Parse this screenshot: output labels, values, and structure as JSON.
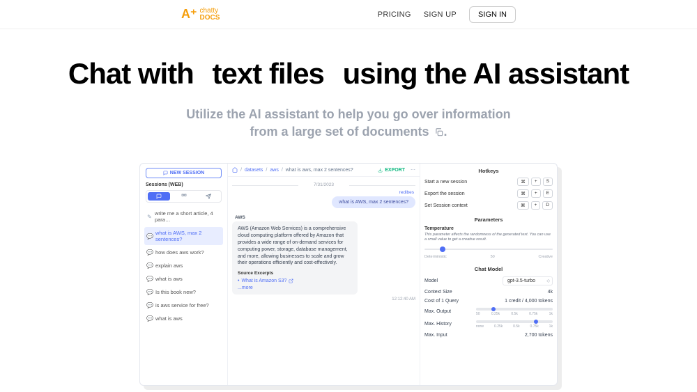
{
  "nav": {
    "pricing": "PRICING",
    "signup": "SIGN UP",
    "signin": "SIGN IN"
  },
  "logo": {
    "chatty": "chatty",
    "docs": "DOCS"
  },
  "hero": {
    "lead": "Chat with",
    "mid": "text files",
    "trail": "using the AI assistant",
    "sub1": "Utilize the AI assistant to help you go over information",
    "sub2": "from a large set of documents"
  },
  "left": {
    "new_session": "NEW SESSION",
    "sessions_label": "Sessions (WEB)",
    "sessions": [
      "write me a short article, 4 para…",
      "what is AWS, max 2 sentences?",
      "how does aws work?",
      "explain aws",
      "what is aws",
      "Is this book new?",
      "is aws service for free?",
      "what is aws"
    ]
  },
  "crumbs": {
    "datasets": "datasets",
    "aws": "aws",
    "current": "what is aws, max 2 sentences?",
    "export": "EXPORT"
  },
  "chat": {
    "date": "7/31/2023",
    "redibes": "redibes",
    "user": "what is AWS, max 2 sentences?",
    "ai_label": "AWS",
    "ai_text": "AWS (Amazon Web Services) is a comprehensive cloud computing platform offered by Amazon that provides a wide range of on-demand services for computing power, storage, database management, and more, allowing businesses to scale and grow their operations efficiently and cost-effectively.",
    "sources_hdr": "Source Excerpts",
    "source1": "What is Amazon S3?",
    "more": "...more",
    "timestamp": "12:12:40 AM"
  },
  "right": {
    "hotkeys_title": "Hotkeys",
    "hk_start": "Start a new session",
    "hk_export": "Export the session",
    "hk_context": "Set Session context",
    "cmd": "⌘",
    "plus": "+",
    "k_s": "S",
    "k_e": "E",
    "k_d": "D",
    "params_title": "Parameters",
    "temp_label": "Temperature",
    "temp_desc": "This parameter affects the randomness of the generated text. You can use a small value to get a creative result.",
    "temp_l0": "Deterministic",
    "temp_l50": "50",
    "temp_l100": "Creative",
    "chatmodel_title": "Chat Model",
    "model_label": "Model",
    "model_value": "gpt-3.5-turbo",
    "ctx_label": "Context Size",
    "ctx_value": "4k",
    "cost_label": "Cost of 1 Query",
    "cost_value": "1 credit  /  4,000 tokens",
    "maxout_label": "Max. Output",
    "maxhist_label": "Max. History",
    "maxin_label": "Max. Input",
    "maxin_value": "2,700 tokens",
    "sl_out": [
      "50",
      "0.25k",
      "0.5k",
      "0.75k",
      "1k"
    ],
    "sl_hist": [
      "none",
      "0.25k",
      "0.5k",
      "0.75k",
      "1k"
    ]
  }
}
